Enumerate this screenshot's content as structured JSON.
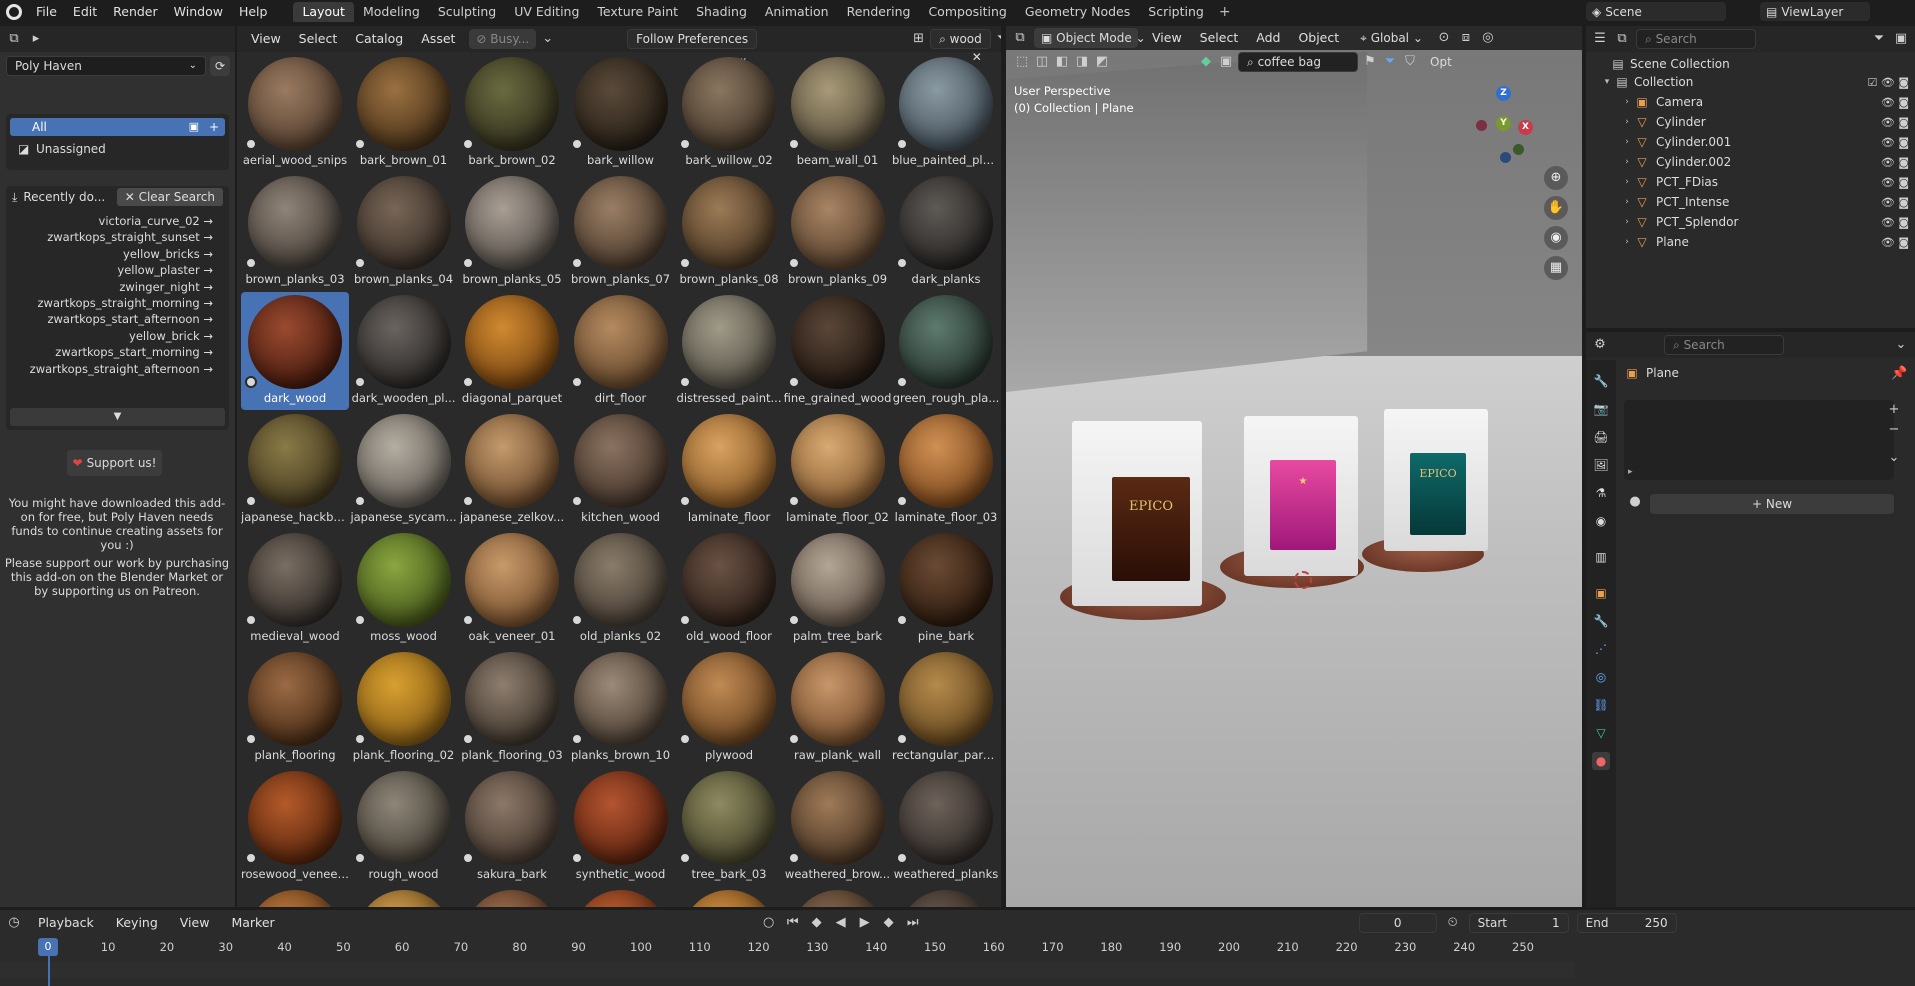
{
  "topbar": {
    "menus": [
      "File",
      "Edit",
      "Render",
      "Window",
      "Help"
    ],
    "workspaces": [
      "Layout",
      "Modeling",
      "Sculpting",
      "UV Editing",
      "Texture Paint",
      "Shading",
      "Animation",
      "Rendering",
      "Compositing",
      "Geometry Nodes",
      "Scripting"
    ],
    "active_workspace": "Layout",
    "scene": "Scene",
    "view_layer": "ViewLayer"
  },
  "asset_browser": {
    "header_menus": [
      "View",
      "Select",
      "Catalog",
      "Asset"
    ],
    "status_button": "Busy...",
    "import_method": "Follow Preferences",
    "search_value": "wood",
    "library": "Poly Haven",
    "catalogs": {
      "all": "All",
      "unassigned": "Unassigned"
    },
    "recent": {
      "title": "Recently do...",
      "clear_label": "Clear Search",
      "items": [
        "victoria_curve_02 →",
        "zwartkops_straight_sunset →",
        "yellow_bricks →",
        "yellow_plaster →",
        "zwinger_night →",
        "zwartkops_straight_morning →",
        "zwartkops_start_afternoon →",
        "yellow_brick →",
        "zwartkops_start_morning →",
        "zwartkops_straight_afternoon →"
      ]
    },
    "support_label": "Support us!",
    "info_1": "You might have downloaded this add-on for free, but Poly Haven needs funds to continue creating assets for you :)",
    "info_2": "Please support our work by purchasing this add-on on the Blender Market or by supporting us on Patreon.",
    "selected_asset": "dark_wood",
    "assets": [
      {
        "name": "aerial_wood_snips",
        "c1": "#9a7a60",
        "c2": "#4a3728"
      },
      {
        "name": "bark_brown_01",
        "c1": "#9a7040",
        "c2": "#3e2a14"
      },
      {
        "name": "bark_brown_02",
        "c1": "#6a6a40",
        "c2": "#2a2818"
      },
      {
        "name": "bark_willow",
        "c1": "#5a4a3a",
        "c2": "#1e1810"
      },
      {
        "name": "bark_willow_02",
        "c1": "#8a7660",
        "c2": "#3a2e22"
      },
      {
        "name": "beam_wall_01",
        "c1": "#a89a78",
        "c2": "#4a4232"
      },
      {
        "name": "blue_painted_pla...",
        "c1": "#8a9aa2",
        "c2": "#3a4650"
      },
      {
        "name": "brown_planks_03",
        "c1": "#908478",
        "c2": "#3a342e"
      },
      {
        "name": "brown_planks_04",
        "c1": "#786656",
        "c2": "#2e2620"
      },
      {
        "name": "brown_planks_05",
        "c1": "#a89e94",
        "c2": "#4a443e"
      },
      {
        "name": "brown_planks_07",
        "c1": "#9a7e64",
        "c2": "#3e3024"
      },
      {
        "name": "brown_planks_08",
        "c1": "#9c7a56",
        "c2": "#3e2e1c"
      },
      {
        "name": "brown_planks_09",
        "c1": "#a88464",
        "c2": "#4a3624"
      },
      {
        "name": "dark_planks",
        "c1": "#5e5a56",
        "c2": "#1e1c1a"
      },
      {
        "name": "dark_wood",
        "c1": "#9a4a30",
        "c2": "#3a1408"
      },
      {
        "name": "dark_wooden_pl...",
        "c1": "#6a6460",
        "c2": "#201e1c"
      },
      {
        "name": "diagonal_parquet",
        "c1": "#d08a30",
        "c2": "#6a3a0c"
      },
      {
        "name": "dirt_floor",
        "c1": "#b48a60",
        "c2": "#5a3e24"
      },
      {
        "name": "distressed_paint...",
        "c1": "#a09a88",
        "c2": "#4a463c"
      },
      {
        "name": "fine_grained_wood",
        "c1": "#5a4638",
        "c2": "#1a120c"
      },
      {
        "name": "green_rough_pla...",
        "c1": "#5e7a6e",
        "c2": "#1e2a24"
      },
      {
        "name": "japanese_hackbe...",
        "c1": "#8a7a48",
        "c2": "#3a3018"
      },
      {
        "name": "japanese_sycam...",
        "c1": "#b4aea2",
        "c2": "#56504a"
      },
      {
        "name": "japanese_zelkov...",
        "c1": "#c49a6c",
        "c2": "#5e3e22"
      },
      {
        "name": "kitchen_wood",
        "c1": "#8a7260",
        "c2": "#3a2c22"
      },
      {
        "name": "laminate_floor",
        "c1": "#d8a260",
        "c2": "#7a4c1c"
      },
      {
        "name": "laminate_floor_02",
        "c1": "#d8aa72",
        "c2": "#7a5028"
      },
      {
        "name": "laminate_floor_03",
        "c1": "#d09054",
        "c2": "#703e14"
      },
      {
        "name": "medieval_wood",
        "c1": "#7a6e62",
        "c2": "#262220"
      },
      {
        "name": "moss_wood",
        "c1": "#8aa640",
        "c2": "#3a4a14"
      },
      {
        "name": "oak_veneer_01",
        "c1": "#c89a6a",
        "c2": "#6a4424"
      },
      {
        "name": "old_planks_02",
        "c1": "#8a7c6a",
        "c2": "#3a322a"
      },
      {
        "name": "old_wood_floor",
        "c1": "#6a5244",
        "c2": "#241812"
      },
      {
        "name": "palm_tree_bark",
        "c1": "#b4a696",
        "c2": "#56483c"
      },
      {
        "name": "pine_bark",
        "c1": "#6a4a34",
        "c2": "#241408"
      },
      {
        "name": "plank_flooring",
        "c1": "#9a6a44",
        "c2": "#3e2410"
      },
      {
        "name": "plank_flooring_02",
        "c1": "#d8a030",
        "c2": "#7a5210"
      },
      {
        "name": "plank_flooring_03",
        "c1": "#8e7e6e",
        "c2": "#322a22"
      },
      {
        "name": "planks_brown_10",
        "c1": "#9c8a78",
        "c2": "#3e3228"
      },
      {
        "name": "plywood",
        "c1": "#c08a54",
        "c2": "#5e3a18"
      },
      {
        "name": "raw_plank_wall",
        "c1": "#c8966a",
        "c2": "#684222"
      },
      {
        "name": "rectangular_parq...",
        "c1": "#b48a4c",
        "c2": "#5a3e18"
      },
      {
        "name": "rosewood_veneer1",
        "c1": "#b45a2a",
        "c2": "#4a1e08"
      },
      {
        "name": "rough_wood",
        "c1": "#8e8678",
        "c2": "#3a342c"
      },
      {
        "name": "sakura_bark",
        "c1": "#8c7868",
        "c2": "#3a2e26"
      },
      {
        "name": "synthetic_wood",
        "c1": "#b45430",
        "c2": "#4e1c0a"
      },
      {
        "name": "tree_bark_03",
        "c1": "#8e8a60",
        "c2": "#3a3822"
      },
      {
        "name": "weathered_brow...",
        "c1": "#9e7a58",
        "c2": "#3e2c1c"
      },
      {
        "name": "weathered_planks",
        "c1": "#6e625a",
        "c2": "#262220"
      },
      {
        "name": "",
        "c1": "#c07a40",
        "c2": "#5a3410"
      },
      {
        "name": "",
        "c1": "#d4a050",
        "c2": "#6a4a18"
      },
      {
        "name": "",
        "c1": "#a07050",
        "c2": "#4a2c18"
      },
      {
        "name": "",
        "c1": "#c06030",
        "c2": "#5a2410"
      },
      {
        "name": "",
        "c1": "#d49040",
        "c2": "#6a4214"
      },
      {
        "name": "",
        "c1": "#8a6a50",
        "c2": "#3a2a1c"
      },
      {
        "name": "",
        "c1": "#6a5a4e",
        "c2": "#2a221c"
      }
    ]
  },
  "viewport": {
    "mode": "Object Mode",
    "menus": [
      "View",
      "Select",
      "Add",
      "Object"
    ],
    "orientation": "Global",
    "search_value": "coffee bag",
    "options_label": "Opt",
    "perspective": "User Perspective",
    "collection_info": "(0) Collection | Plane",
    "gizmo": {
      "x": "X",
      "y": "Y",
      "z": "Z"
    },
    "bag_brand": "EPICO"
  },
  "outliner": {
    "search_placeholder": "Search",
    "root": "Scene Collection",
    "collection": "Collection",
    "objects": [
      "Camera",
      "Cylinder",
      "Cylinder.001",
      "Cylinder.002",
      "PCT_FDias",
      "PCT_Intense",
      "PCT_Splendor",
      "Plane"
    ]
  },
  "properties": {
    "search_placeholder": "Search",
    "object_name": "Plane",
    "new_label": "New"
  },
  "timeline": {
    "menus": [
      "Playback",
      "Keying",
      "View",
      "Marker"
    ],
    "current_frame": "0",
    "start_label": "Start",
    "start": "1",
    "end_label": "End",
    "end": "250",
    "ticks": [
      "0",
      "10",
      "20",
      "30",
      "40",
      "50",
      "60",
      "70",
      "80",
      "90",
      "100",
      "110",
      "120",
      "130",
      "140",
      "150",
      "160",
      "170",
      "180",
      "190",
      "200",
      "210",
      "220",
      "230",
      "240",
      "250"
    ]
  },
  "colors": {
    "accent": "#4772b3",
    "panel": "#303030",
    "header": "#1d1d1d"
  }
}
